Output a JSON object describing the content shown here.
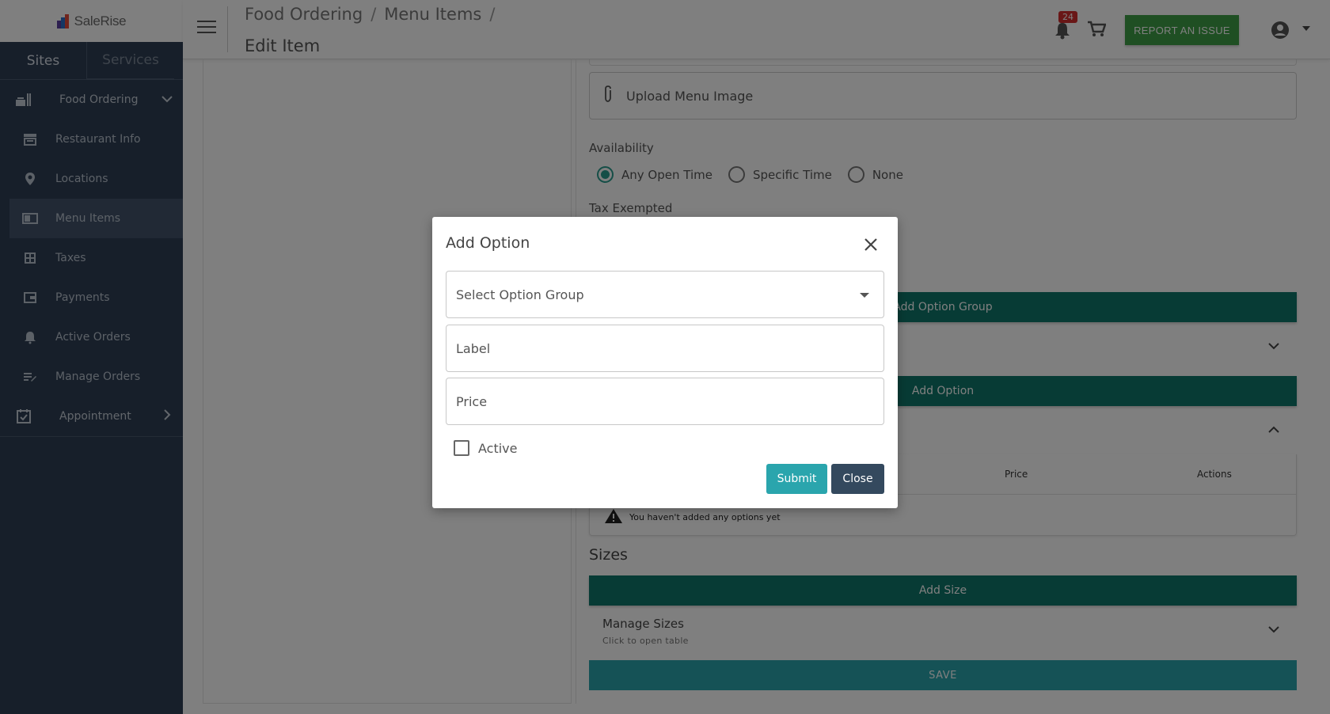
{
  "sidebar": {
    "logo_text": "SaleRise",
    "tabs": [
      {
        "label": "Sites"
      },
      {
        "label": "Services"
      }
    ],
    "food_ordering_label": "Food Ordering",
    "items": [
      {
        "label": "Restaurant Info",
        "icon": "storefront-icon"
      },
      {
        "label": "Locations",
        "icon": "location-pin-icon"
      },
      {
        "label": "Menu Items",
        "icon": "menu-book-icon"
      },
      {
        "label": "Taxes",
        "icon": "calculator-icon"
      },
      {
        "label": "Payments",
        "icon": "wallet-icon"
      },
      {
        "label": "Active Orders",
        "icon": "bell-ring-icon"
      },
      {
        "label": "Manage Orders",
        "icon": "edit-list-icon"
      }
    ],
    "appointment_label": "Appointment"
  },
  "header": {
    "breadcrumb": [
      "Food Ordering",
      "Menu Items",
      ""
    ],
    "title": "Edit Item",
    "notification_count": "24",
    "report_label": "REPORT AN ISSUE"
  },
  "form": {
    "upload_label": "Upload Menu Image",
    "availability_label": "Availability",
    "availability_options": [
      "Any Open Time",
      "Specific Time",
      "None"
    ],
    "tax_label": "Tax Exempted",
    "add_option_group_label": "Add Option Group",
    "add_option_label": "Add Option",
    "table_headers": {
      "price": "Price",
      "actions": "Actions"
    },
    "empty_note": "You haven't added any options yet",
    "sizes_title": "Sizes",
    "add_size_label": "Add Size",
    "manage_sizes_title": "Manage Sizes",
    "manage_sizes_sub": "Click to open table",
    "save_label": "SAVE"
  },
  "modal": {
    "title": "Add Option",
    "select_placeholder": "Select Option Group",
    "label_placeholder": "Label",
    "price_placeholder": "Price",
    "active_label": "Active",
    "submit_label": "Submit",
    "close_label": "Close"
  },
  "colors": {
    "sidebar_bg": "#2f3f55",
    "teal_dark": "#0f766a",
    "teal_light": "#2aa5ad",
    "report_green": "#3f9f46",
    "close_btn": "#34495e"
  }
}
